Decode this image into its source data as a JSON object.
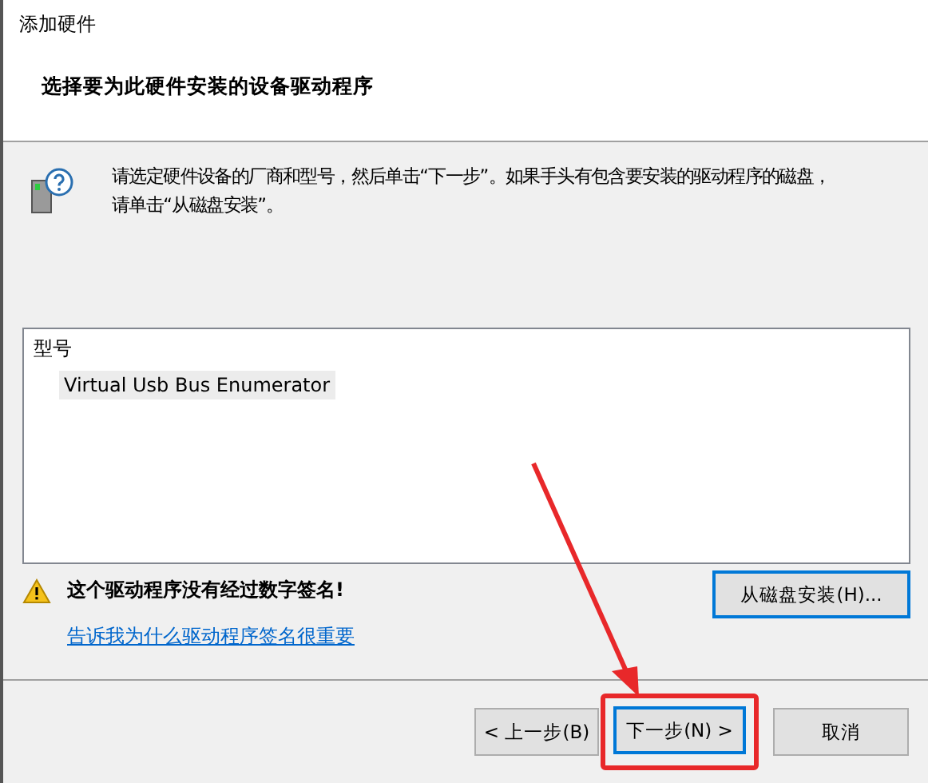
{
  "window": {
    "title": "添加硬件"
  },
  "heading": "选择要为此硬件安装的设备驱动程序",
  "instruction": [
    "请选定硬件设备的厂商和型号，然后单击“下一步”。如果手头有包含要安装的驱动程序的磁盘，",
    "请单击“从磁盘安装”。"
  ],
  "model_list": {
    "header": "型号",
    "items": [
      {
        "label": "Virtual Usb Bus Enumerator",
        "selected": true
      }
    ]
  },
  "warning": "这个驱动程序没有经过数字签名!",
  "disk_button": {
    "label": "从磁盘安装(H)...",
    "focused": true
  },
  "link": "告诉我为什么驱动程序签名很重要",
  "buttons": [
    {
      "label": "< 上一步(B)",
      "focused": false,
      "highlighted": false
    },
    {
      "label": "下一步(N) >",
      "focused": true,
      "highlighted": true
    },
    {
      "label": "取消",
      "focused": false,
      "highlighted": false
    }
  ]
}
